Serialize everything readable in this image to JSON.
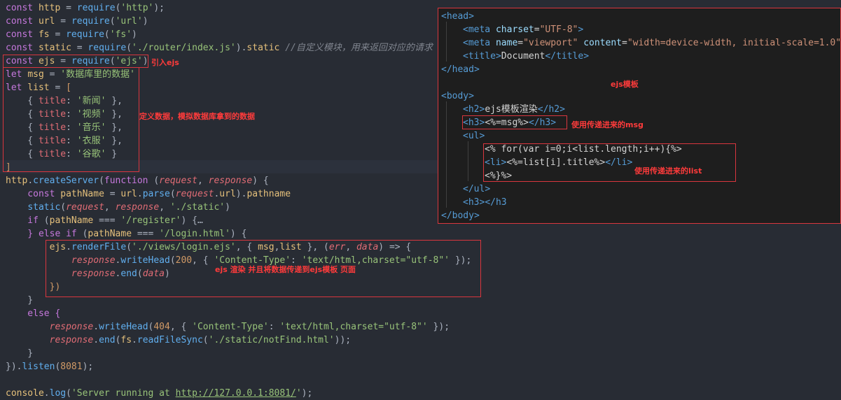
{
  "left_code": {
    "l1": [
      "const ",
      "http",
      " = ",
      "require",
      "(",
      "'http'",
      ");"
    ],
    "l2": [
      "const ",
      "url",
      " = ",
      "require",
      "(",
      "'url'",
      ")"
    ],
    "l3": [
      "const ",
      "fs",
      " = ",
      "require",
      "(",
      "'fs'",
      ")"
    ],
    "l4": [
      "const ",
      "static",
      " = ",
      "require",
      "(",
      "'./router/index.js'",
      ").",
      "static",
      " //自定义模块，用来返回对应的请求"
    ],
    "l5": [
      "const ",
      "ejs",
      " = ",
      "require",
      "(",
      "'ejs'",
      ")"
    ],
    "l6": [
      "let ",
      "msg",
      " = ",
      "'数据库里的数据'"
    ],
    "l7": [
      "let ",
      "list",
      " = ",
      "["
    ],
    "l8": [
      "    { ",
      "title",
      ": ",
      "'新闻'",
      " },"
    ],
    "l9": [
      "    { ",
      "title",
      ": ",
      "'视频'",
      " },"
    ],
    "l10": [
      "    { ",
      "title",
      ": ",
      "'音乐'",
      " },"
    ],
    "l11": [
      "    { ",
      "title",
      ": ",
      "'衣服'",
      " },"
    ],
    "l12": [
      "    { ",
      "title",
      ": ",
      "'谷歌'",
      " }"
    ],
    "l13": [
      "]"
    ],
    "l14": [
      "http",
      ".",
      "createServer",
      "(",
      "function ",
      "(",
      "request",
      ", ",
      "response",
      ") {"
    ],
    "l15": [
      "    const ",
      "pathName",
      " = ",
      "url",
      ".",
      "parse",
      "(",
      "request",
      ".",
      "url",
      ").",
      "pathname"
    ],
    "l16": [
      "    ",
      "static",
      "(",
      "request",
      ", ",
      "response",
      ", ",
      "'./static'",
      ")"
    ],
    "l17": [
      "    if ",
      "(",
      "pathName",
      " === ",
      "'/register'",
      ") {…"
    ],
    "l18": [
      "    } else if ",
      "(",
      "pathName",
      " === ",
      "'/login.html'",
      ") {"
    ],
    "l19": [
      "        ",
      "ejs",
      ".",
      "renderFile",
      "(",
      "'./views/login.ejs'",
      ", { ",
      "msg",
      ",",
      "list",
      " }, (",
      "err",
      ", ",
      "data",
      ") => {"
    ],
    "l20": [
      "            ",
      "response",
      ".",
      "writeHead",
      "(",
      "200",
      ", { ",
      "'Content-Type'",
      ": ",
      "'text/html,charset=\"utf-8\"'",
      " });"
    ],
    "l21": [
      "            ",
      "response",
      ".",
      "end",
      "(",
      "data",
      ")"
    ],
    "l22": [
      "        })"
    ],
    "l23": [
      "    }"
    ],
    "l24": [
      "    else {"
    ],
    "l25": [
      "        ",
      "response",
      ".",
      "writeHead",
      "(",
      "404",
      ", { ",
      "'Content-Type'",
      ": ",
      "'text/html,charset=\"utf-8\"'",
      " });"
    ],
    "l26": [
      "        ",
      "response",
      ".",
      "end",
      "(",
      "fs",
      ".",
      "readFileSync",
      "(",
      "'./static/notFind.html'",
      "));"
    ],
    "l27": [
      "    }"
    ],
    "l28": [
      "}).",
      "listen",
      "(",
      "8081",
      ");"
    ],
    "l29": [
      ""
    ],
    "l30": [
      "console",
      ".",
      "log",
      "(",
      "'Server running at ",
      "http://127.0.0.1:8081/",
      "'",
      ");"
    ]
  },
  "annotations": {
    "import_ejs": "引入ejs",
    "define_data": "定义数据，模拟数据库拿到的数据",
    "render_note": "ejs 渲染 并且将数据传递到ejs模板  页面",
    "ejs_template": "ejs模板",
    "use_msg": "使用传递进来的msg",
    "use_list": "使用传递进来的list"
  },
  "right_code": {
    "r1": [
      "<",
      "head",
      ">"
    ],
    "r2": [
      "<",
      "meta",
      " ",
      "charset",
      "=",
      "\"UTF-8\"",
      ">"
    ],
    "r3": [
      "<",
      "meta",
      " ",
      "name",
      "=",
      "\"viewport\"",
      " ",
      "content",
      "=",
      "\"width=device-width, initial-scale=1.0\"",
      ">"
    ],
    "r4": [
      "<",
      "title",
      ">",
      "Document",
      "</",
      "title",
      ">"
    ],
    "r5": [
      "</",
      "head",
      ">"
    ],
    "r6": [
      ""
    ],
    "r7": [
      "<",
      "body",
      ">"
    ],
    "r8": [
      "<",
      "h2",
      ">",
      "ejs模板渲染",
      "</",
      "h2",
      ">"
    ],
    "r9": [
      "<",
      "h3",
      ">",
      "<%=msg%>",
      "</",
      "h3",
      ">"
    ],
    "r10": [
      "<",
      "ul",
      ">"
    ],
    "r11": [
      "<% for(var i=0;i<list.length;i++){%>"
    ],
    "r12": [
      "<",
      "li",
      ">",
      "<%=list[i].title%>",
      "</",
      "li",
      ">"
    ],
    "r13": [
      "<%}%>"
    ],
    "r14": [
      "</",
      "ul",
      ">"
    ],
    "r15": [
      "<",
      "h3",
      ">",
      "</",
      "h3",
      ">"
    ],
    "r16": [
      "</",
      "body",
      ">"
    ]
  },
  "colors": {
    "editor_bg": "#282c34",
    "panel_bg": "#1e1e1e",
    "annotation_red": "#ff3b3b",
    "box_border": "#d9363e"
  }
}
